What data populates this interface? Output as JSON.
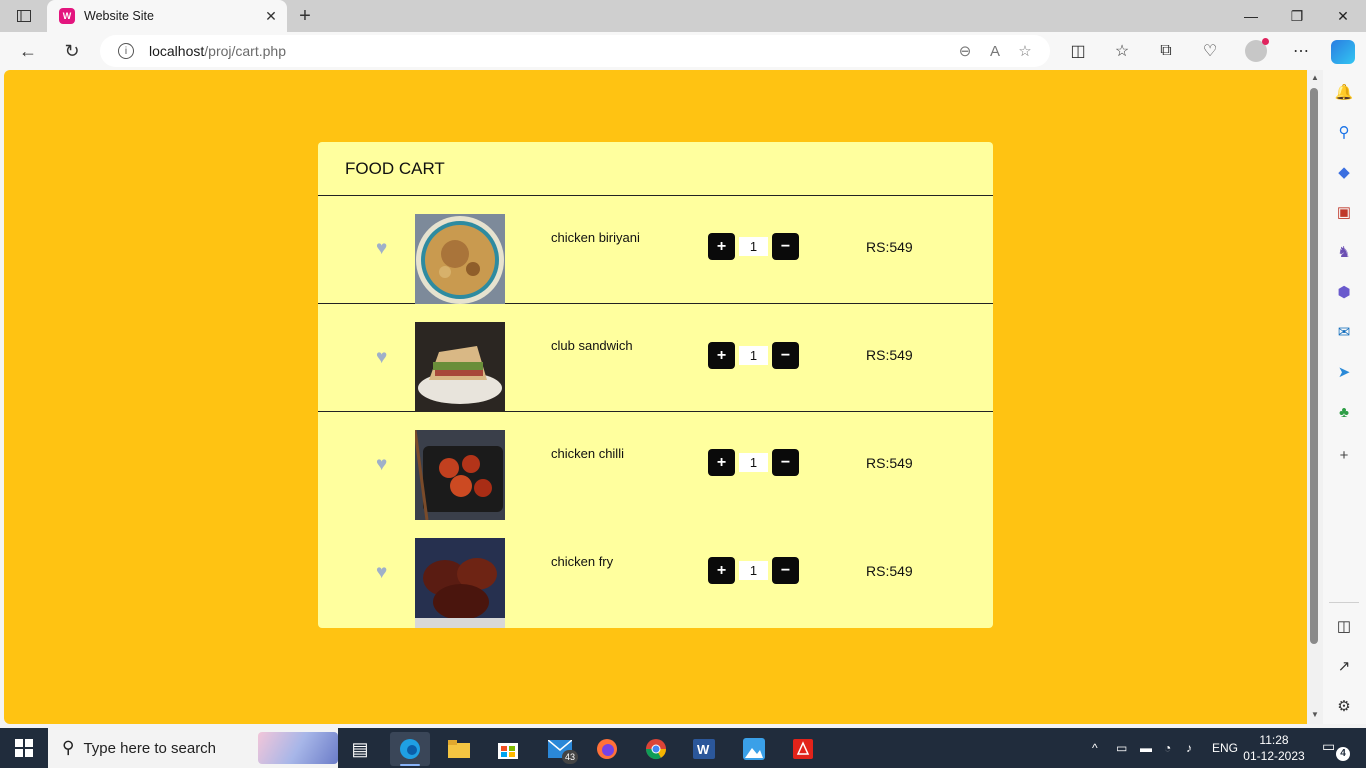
{
  "browser": {
    "tab_title": "Website Site",
    "url_host": "localhost",
    "url_path": "/proj/cart.php",
    "new_tab_glyph": "+",
    "close_glyph": "✕"
  },
  "cart": {
    "title": "FOOD CART",
    "items": [
      {
        "name": "chicken biriyani",
        "qty": "1",
        "price": "RS:549",
        "image_icon": "biriyani-photo"
      },
      {
        "name": "club sandwich",
        "qty": "1",
        "price": "RS:549",
        "image_icon": "sandwich-photo"
      },
      {
        "name": "chicken chilli",
        "qty": "1",
        "price": "RS:549",
        "image_icon": "chicken-chilli-photo"
      },
      {
        "name": "chicken fry",
        "qty": "1",
        "price": "RS:549",
        "image_icon": "chicken-fry-photo"
      }
    ],
    "plus_glyph": "+",
    "minus_glyph": "−",
    "heart_glyph": "♥"
  },
  "taskbar": {
    "search_placeholder": "Type here to search",
    "mail_badge": "43",
    "language": "ENG",
    "time": "11:28",
    "date": "01-12-2023",
    "notifications": "4"
  },
  "colors": {
    "page_background": "#ffc312",
    "cart_background": "#ffff9e",
    "button_background": "#0a0a0a",
    "heart": "#9fb0c9"
  }
}
